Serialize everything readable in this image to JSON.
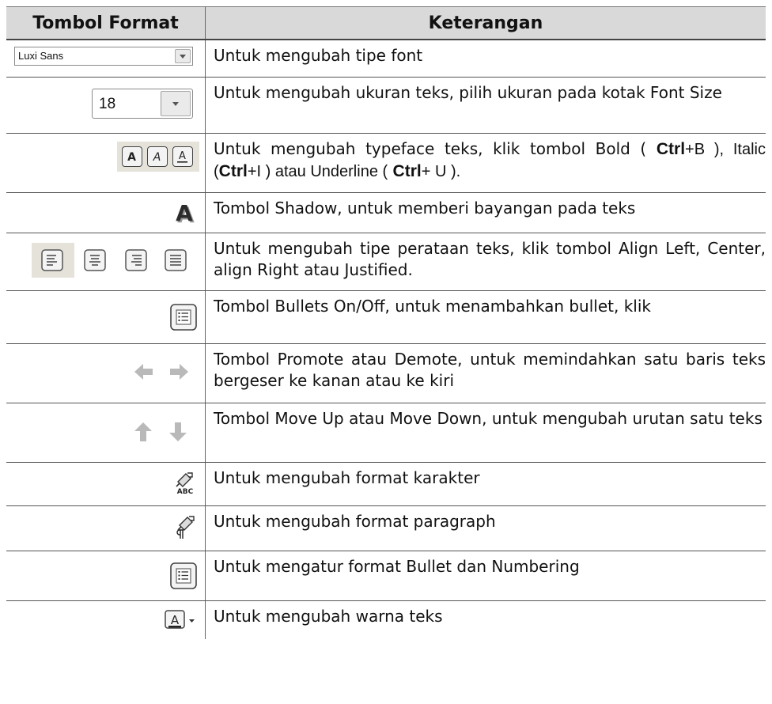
{
  "header": {
    "col1": "Tombol Format",
    "col2": "Keterangan"
  },
  "font_combo": {
    "value": "Luxi Sans"
  },
  "size_combo": {
    "value": "18"
  },
  "typeface_icons": {
    "bold_letter": "A",
    "italic_letter": "A",
    "underline_letter": "A"
  },
  "shadow_icon": {
    "letter": "A"
  },
  "char_icon": {
    "label": "ABC"
  },
  "color_icon": {
    "letter": "A"
  },
  "rows": {
    "font_type": {
      "text": "Untuk mengubah tipe font"
    },
    "font_size": {
      "text": "Untuk mengubah ukuran teks, pilih ukuran pada kotak Font Size"
    },
    "typeface": {
      "t1": "Untuk mengubah typeface teks, klik tombol Bold (",
      "k1": "Ctrl",
      "t2": "+B ), Italic (",
      "k2": "Ctrl",
      "t3": "+I ) atau Underline (",
      "k3": "Ctrl",
      "t4": "+ U )."
    },
    "shadow": {
      "text": "Tombol Shadow, untuk memberi bayangan pada teks"
    },
    "align": {
      "text": "Untuk mengubah tipe perataan teks, klik tombol Align Left, Center, align Right atau Justified."
    },
    "bullets": {
      "text": "Tombol Bullets On/Off, untuk menambahkan bullet, klik"
    },
    "promote": {
      "text": "Tombol Promote atau Demote, untuk memindahkan satu baris teks bergeser ke kanan atau ke kiri"
    },
    "move": {
      "text": "Tombol Move Up atau Move Down, untuk mengubah urutan satu  teks"
    },
    "char_format": {
      "text": "Untuk mengubah format karakter"
    },
    "para_format": {
      "text": "Untuk mengubah format paragraph"
    },
    "bullet_numbering": {
      "text": "Untuk mengatur format Bullet dan Numbering"
    },
    "color": {
      "text": "Untuk mengubah warna teks"
    }
  },
  "icons": [
    "dropdown-icon",
    "bold-icon",
    "italic-icon",
    "underline-icon",
    "shadow-icon",
    "align-left-icon",
    "align-center-icon",
    "align-right-icon",
    "justify-icon",
    "bullets-icon",
    "promote-icon",
    "demote-icon",
    "move-up-icon",
    "move-down-icon",
    "character-format-icon",
    "paragraph-format-icon",
    "bullet-numbering-icon",
    "font-color-icon"
  ]
}
